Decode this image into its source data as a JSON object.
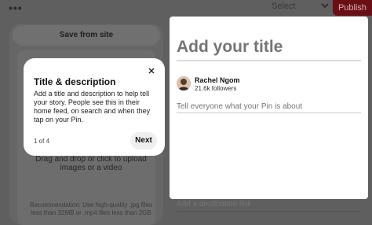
{
  "topbar": {
    "more_label": "•••",
    "select_label": "Select",
    "publish_label": "Publish"
  },
  "left": {
    "save_from_site_label": "Save from site",
    "upload_label": "Drag and drop or click to upload images or a video",
    "recommendation": "Recommendation: Use high-quality .jpg files less than 32MB or .mp4 files less than 2GB"
  },
  "right": {
    "title_placeholder": "Add your title",
    "user_name": "Rachel Ngom",
    "followers": "21.6k followers",
    "about_placeholder": "Tell everyone what your Pin is about",
    "destination_placeholder": "Add a destination link"
  },
  "tooltip": {
    "title": "Title & description",
    "body": "Add a title and description to help tell your story. People see this in their home feed, on search and when they tap on your Pin.",
    "step": "1 of 4",
    "next_label": "Next"
  },
  "icons": {
    "close": "close-icon",
    "chevron": "chevron-down-icon",
    "more": "more-icon"
  },
  "colors": {
    "publish_bg": "#6b0f16",
    "overlay": "#5f5f5f"
  }
}
